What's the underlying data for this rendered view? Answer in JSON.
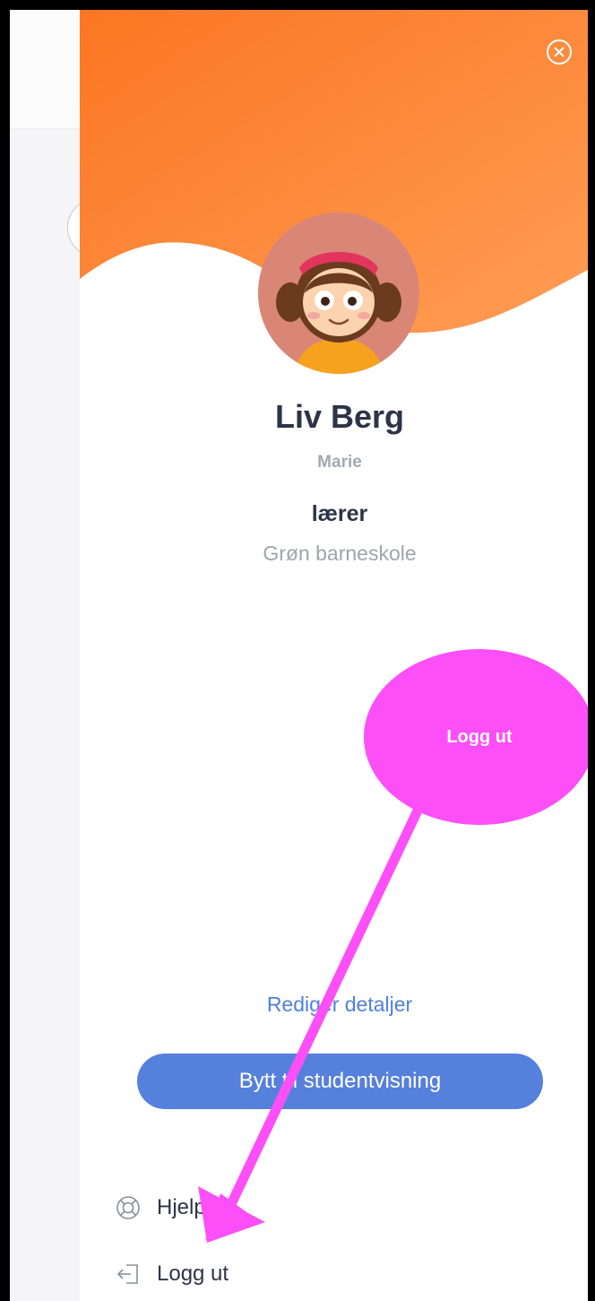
{
  "profile": {
    "name": "Liv Berg",
    "nickname": "Marie",
    "role": "lærer",
    "school": "Grøn barneskole"
  },
  "actions": {
    "edit_details": "Rediger detaljer",
    "switch_view": "Bytt til studentvisning"
  },
  "menu": {
    "help": "Hjelp",
    "logout": "Logg ut"
  },
  "annotation": {
    "label": "Logg ut"
  },
  "icons": {
    "close": "close-circle-icon",
    "help": "lifebuoy-icon",
    "logout": "logout-icon"
  },
  "colors": {
    "header_gradient_start": "#fb7a23",
    "header_gradient_end": "#ff9a50",
    "primary": "#5580dc",
    "link": "#4f7fe0",
    "annotation": "#fd4ff7",
    "text_dark": "#2e3447"
  }
}
